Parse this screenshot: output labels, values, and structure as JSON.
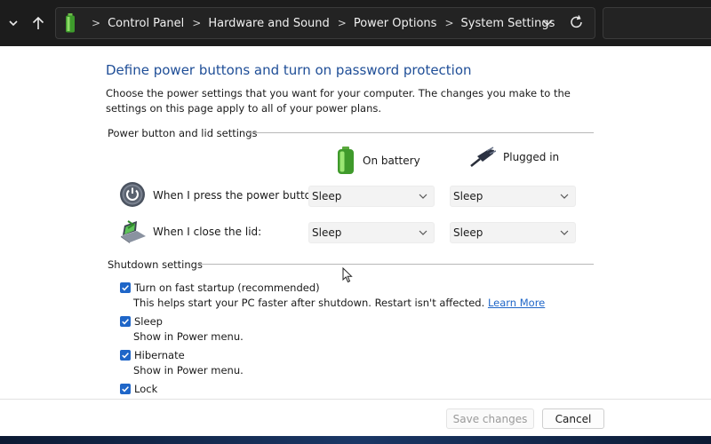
{
  "address_bar": {
    "breadcrumbs": [
      "Control Panel",
      "Hardware and Sound",
      "Power Options",
      "System Settings"
    ]
  },
  "page": {
    "title": "Define power buttons and turn on password protection",
    "description": "Choose the power settings that you want for your computer. The changes you make to the settings on this page apply to all of your power plans."
  },
  "power_section": {
    "heading": "Power button and lid settings",
    "columns": {
      "battery": "On battery",
      "plugged": "Plugged in"
    },
    "rows": [
      {
        "label": "When I press the power button:",
        "battery": "Sleep",
        "plugged": "Sleep"
      },
      {
        "label": "When I close the lid:",
        "battery": "Sleep",
        "plugged": "Sleep"
      }
    ]
  },
  "shutdown_section": {
    "heading": "Shutdown settings",
    "items": [
      {
        "label": "Turn on fast startup (recommended)",
        "checked": true,
        "description": "This helps start your PC faster after shutdown. Restart isn't affected.",
        "link": "Learn More"
      },
      {
        "label": "Sleep",
        "checked": true,
        "description": "Show in Power menu."
      },
      {
        "label": "Hibernate",
        "checked": true,
        "description": "Show in Power menu."
      },
      {
        "label": "Lock",
        "checked": true
      }
    ]
  },
  "footer": {
    "save_label": "Save changes",
    "cancel_label": "Cancel"
  },
  "colors": {
    "title": "#1f4e97",
    "accent": "#1f66c8",
    "titlebar": "#1c1c1c"
  }
}
